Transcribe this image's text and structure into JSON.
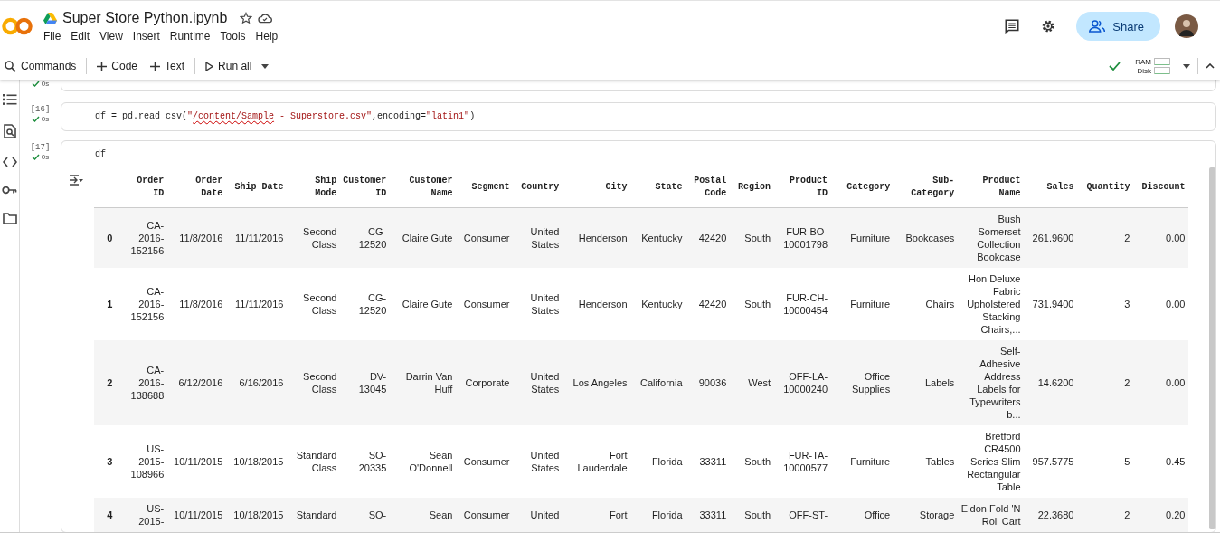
{
  "header": {
    "title": "Super Store Python.ipynb",
    "menu": [
      "File",
      "Edit",
      "View",
      "Insert",
      "Runtime",
      "Tools",
      "Help"
    ],
    "share": "Share"
  },
  "toolbar": {
    "items": [
      {
        "label": "Commands",
        "kind": "search"
      },
      {
        "label": "Code",
        "kind": "add"
      },
      {
        "label": "Text",
        "kind": "add"
      },
      {
        "label": "Run all",
        "kind": "run"
      }
    ],
    "ram": "RAM",
    "disk": "Disk"
  },
  "sidebar": {
    "items": [
      {
        "kind": "list"
      },
      {
        "kind": "find"
      },
      {
        "kind": "code"
      },
      {
        "kind": "key"
      },
      {
        "kind": "folder"
      }
    ]
  },
  "cells": [
    {
      "kind": "stub",
      "time": "0s"
    },
    {
      "kind": "code",
      "count": "[16]",
      "time": "0s",
      "code": [
        {
          "text": "df = pd.read_csv(",
          "kind": "plain"
        },
        {
          "text": "\"",
          "kind": "string",
          "underlined": false
        },
        {
          "text": "/content/Sample",
          "kind": "string",
          "underlined": true
        },
        {
          "text": " - Superstore.csv\"",
          "kind": "string",
          "underlined": false
        },
        {
          "text": ",encoding=",
          "kind": "plain"
        },
        {
          "text": "\"latin1\"",
          "kind": "string",
          "underlined": false
        },
        {
          "text": ")",
          "kind": "plain"
        }
      ]
    },
    {
      "kind": "code",
      "count": "[17]",
      "time": "0s",
      "code": [
        {
          "text": "df",
          "kind": "plain"
        }
      ],
      "output": {
        "table": {
          "columns": [
            "Order ID",
            "Order Date",
            "Ship Date",
            "Ship Mode",
            "Customer ID",
            "Customer Name",
            "Segment",
            "Country",
            "City",
            "State",
            "Postal Code",
            "Region",
            "Product ID",
            "Category",
            "Sub-Category",
            "Product Name",
            "Sales",
            "Quantity",
            "Discount"
          ],
          "rows": [
            {
              "index": "0",
              "cells": [
                "CA-2016-152156",
                "11/8/2016",
                "11/11/2016",
                "Second Class",
                "CG-12520",
                "Claire Gute",
                "Consumer",
                "United States",
                "Henderson",
                "Kentucky",
                "42420",
                "South",
                "FUR-BO-10001798",
                "Furniture",
                "Bookcases",
                "Bush Somerset Collection Bookcase",
                "261.9600",
                "2",
                "0.00"
              ]
            },
            {
              "index": "1",
              "cells": [
                "CA-2016-152156",
                "11/8/2016",
                "11/11/2016",
                "Second Class",
                "CG-12520",
                "Claire Gute",
                "Consumer",
                "United States",
                "Henderson",
                "Kentucky",
                "42420",
                "South",
                "FUR-CH-10000454",
                "Furniture",
                "Chairs",
                "Hon Deluxe Fabric Upholstered Stacking Chairs,...",
                "731.9400",
                "3",
                "0.00"
              ]
            },
            {
              "index": "2",
              "cells": [
                "CA-2016-138688",
                "6/12/2016",
                "6/16/2016",
                "Second Class",
                "DV-13045",
                "Darrin Van Huff",
                "Corporate",
                "United States",
                "Los Angeles",
                "California",
                "90036",
                "West",
                "OFF-LA-10000240",
                "Office Supplies",
                "Labels",
                "Self-Adhesive Address Labels for Typewriters b...",
                "14.6200",
                "2",
                "0.00"
              ]
            },
            {
              "index": "3",
              "cells": [
                "US-2015-108966",
                "10/11/2015",
                "10/18/2015",
                "Standard Class",
                "SO-20335",
                "Sean O'Donnell",
                "Consumer",
                "United States",
                "Fort Lauderdale",
                "Florida",
                "33311",
                "South",
                "FUR-TA-10000577",
                "Furniture",
                "Tables",
                "Bretford CR4500 Series Slim Rectangular Table",
                "957.5775",
                "5",
                "0.45"
              ]
            },
            {
              "index": "4",
              "cells": [
                "US-2015-",
                "10/11/2015",
                "10/18/2015",
                "Standard",
                "SO-",
                "Sean",
                "Consumer",
                "United",
                "Fort",
                "Florida",
                "33311",
                "South",
                "OFF-ST-",
                "Office",
                "Storage",
                "Eldon Fold 'N Roll Cart",
                "22.3680",
                "2",
                "0.20"
              ]
            }
          ]
        }
      }
    }
  ]
}
